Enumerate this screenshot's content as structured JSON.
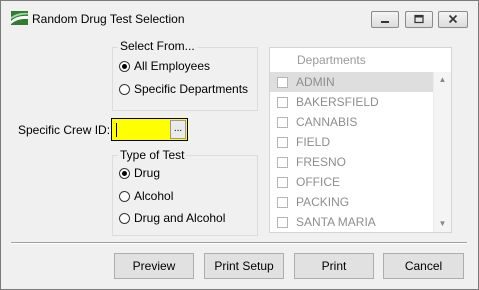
{
  "window": {
    "title": "Random Drug Test Selection",
    "controls": {
      "minimize_icon": "minimize-icon",
      "maximize_icon": "maximize-icon",
      "close_icon": "close-icon"
    }
  },
  "select_from": {
    "title": "Select From...",
    "options": [
      {
        "label": "All Employees",
        "selected": true
      },
      {
        "label": "Specific Departments",
        "selected": false
      }
    ]
  },
  "crew": {
    "label": "Specific Crew ID:",
    "value": "",
    "lookup_label": "...",
    "highlight_color": "#ffff00"
  },
  "type_of_test": {
    "title": "Type of Test",
    "options": [
      {
        "label": "Drug",
        "selected": true
      },
      {
        "label": "Alcohol",
        "selected": false
      },
      {
        "label": "Drug and Alcohol",
        "selected": false
      }
    ]
  },
  "departments": {
    "header": "Departments",
    "disabled": true,
    "items": [
      {
        "label": "ADMIN",
        "checked": false,
        "highlighted": true
      },
      {
        "label": "BAKERSFIELD",
        "checked": false
      },
      {
        "label": "CANNABIS",
        "checked": false
      },
      {
        "label": "FIELD",
        "checked": false
      },
      {
        "label": "FRESNO",
        "checked": false
      },
      {
        "label": "OFFICE",
        "checked": false
      },
      {
        "label": "PACKING",
        "checked": false
      },
      {
        "label": "SANTA MARIA",
        "checked": false
      }
    ]
  },
  "buttons": {
    "preview": "Preview",
    "print_setup": "Print Setup",
    "print": "Print",
    "cancel": "Cancel"
  }
}
